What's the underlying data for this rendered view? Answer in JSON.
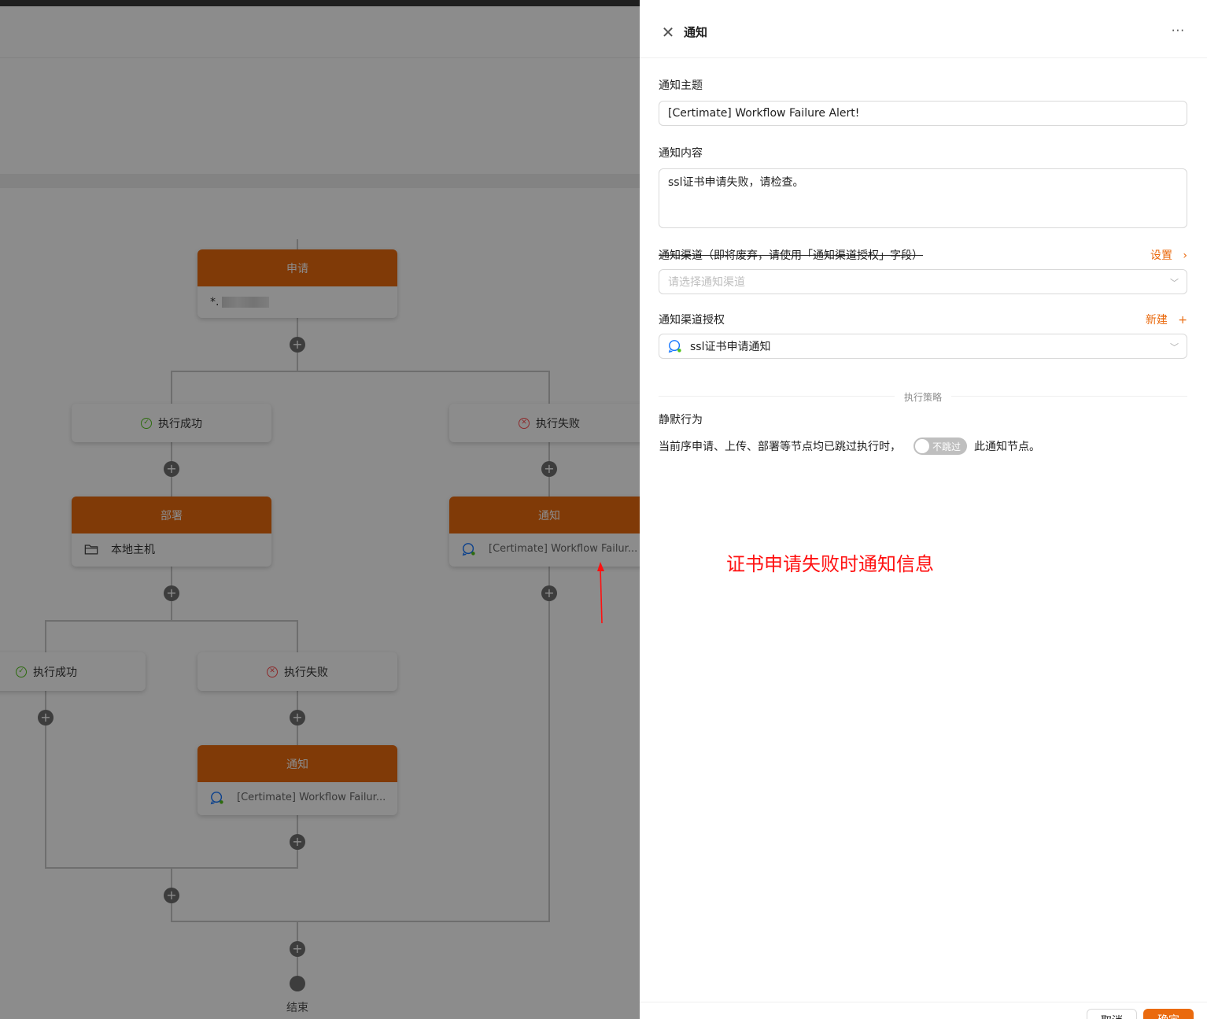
{
  "workflow": {
    "apply_node": {
      "title": "申请",
      "domain": "*."
    },
    "branch_success": "执行成功",
    "branch_failure": "执行失败",
    "deploy_node": {
      "title": "部署",
      "provider": "本地主机"
    },
    "notify_node": {
      "title": "通知",
      "subject": "[Certimate] Workflow Failur..."
    },
    "end_label": "结束"
  },
  "drawer": {
    "title": "通知",
    "more_label": "···",
    "subject": {
      "label": "通知主题",
      "value": "[Certimate] Workflow Failure Alert!"
    },
    "message": {
      "label": "通知内容",
      "value": "ssl证书申请失败，请检查。"
    },
    "channel": {
      "label": "通知渠道（即将废弃，请使用「通知渠道授权」字段）",
      "action": "设置",
      "placeholder": "请选择通知渠道"
    },
    "provider_access": {
      "label": "通知渠道授权",
      "action": "新建",
      "value": "ssl证书申请通知"
    },
    "strategy_divider": "执行策略",
    "silent": {
      "title": "静默行为",
      "prefix": "当前序申请、上传、部署等节点均已跳过执行时，",
      "switch_label": "不跳过",
      "suffix": "此通知节点。"
    },
    "annotation": "证书申请失败时通知信息",
    "cancel_label": "取消",
    "ok_label": "确定"
  },
  "colors": {
    "accent": "#ea6a0e",
    "success": "#52c41a",
    "error": "#ff4d4f",
    "annotation": "#ff1010"
  }
}
